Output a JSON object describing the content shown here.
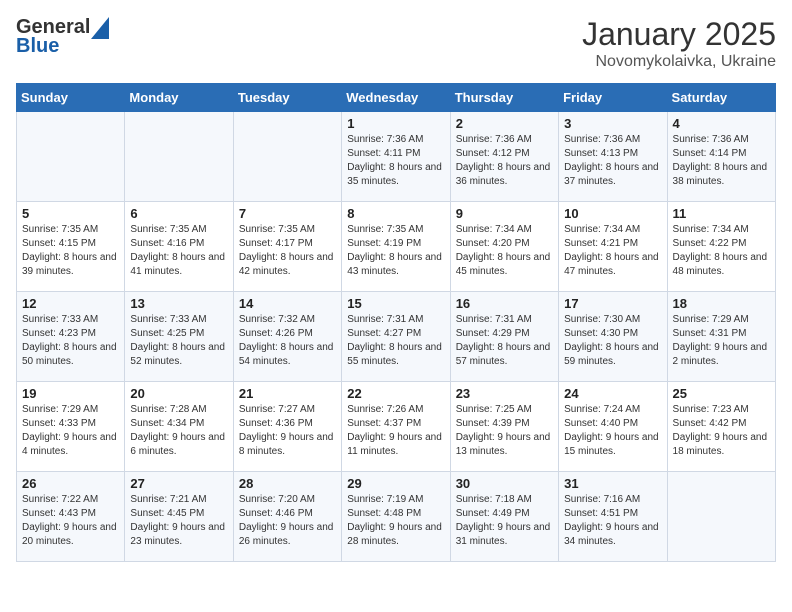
{
  "header": {
    "logo_general": "General",
    "logo_blue": "Blue",
    "month": "January 2025",
    "location": "Novomykolaivka, Ukraine"
  },
  "weekdays": [
    "Sunday",
    "Monday",
    "Tuesday",
    "Wednesday",
    "Thursday",
    "Friday",
    "Saturday"
  ],
  "weeks": [
    [
      {
        "day": "",
        "info": ""
      },
      {
        "day": "",
        "info": ""
      },
      {
        "day": "",
        "info": ""
      },
      {
        "day": "1",
        "info": "Sunrise: 7:36 AM\nSunset: 4:11 PM\nDaylight: 8 hours and 35 minutes."
      },
      {
        "day": "2",
        "info": "Sunrise: 7:36 AM\nSunset: 4:12 PM\nDaylight: 8 hours and 36 minutes."
      },
      {
        "day": "3",
        "info": "Sunrise: 7:36 AM\nSunset: 4:13 PM\nDaylight: 8 hours and 37 minutes."
      },
      {
        "day": "4",
        "info": "Sunrise: 7:36 AM\nSunset: 4:14 PM\nDaylight: 8 hours and 38 minutes."
      }
    ],
    [
      {
        "day": "5",
        "info": "Sunrise: 7:35 AM\nSunset: 4:15 PM\nDaylight: 8 hours and 39 minutes."
      },
      {
        "day": "6",
        "info": "Sunrise: 7:35 AM\nSunset: 4:16 PM\nDaylight: 8 hours and 41 minutes."
      },
      {
        "day": "7",
        "info": "Sunrise: 7:35 AM\nSunset: 4:17 PM\nDaylight: 8 hours and 42 minutes."
      },
      {
        "day": "8",
        "info": "Sunrise: 7:35 AM\nSunset: 4:19 PM\nDaylight: 8 hours and 43 minutes."
      },
      {
        "day": "9",
        "info": "Sunrise: 7:34 AM\nSunset: 4:20 PM\nDaylight: 8 hours and 45 minutes."
      },
      {
        "day": "10",
        "info": "Sunrise: 7:34 AM\nSunset: 4:21 PM\nDaylight: 8 hours and 47 minutes."
      },
      {
        "day": "11",
        "info": "Sunrise: 7:34 AM\nSunset: 4:22 PM\nDaylight: 8 hours and 48 minutes."
      }
    ],
    [
      {
        "day": "12",
        "info": "Sunrise: 7:33 AM\nSunset: 4:23 PM\nDaylight: 8 hours and 50 minutes."
      },
      {
        "day": "13",
        "info": "Sunrise: 7:33 AM\nSunset: 4:25 PM\nDaylight: 8 hours and 52 minutes."
      },
      {
        "day": "14",
        "info": "Sunrise: 7:32 AM\nSunset: 4:26 PM\nDaylight: 8 hours and 54 minutes."
      },
      {
        "day": "15",
        "info": "Sunrise: 7:31 AM\nSunset: 4:27 PM\nDaylight: 8 hours and 55 minutes."
      },
      {
        "day": "16",
        "info": "Sunrise: 7:31 AM\nSunset: 4:29 PM\nDaylight: 8 hours and 57 minutes."
      },
      {
        "day": "17",
        "info": "Sunrise: 7:30 AM\nSunset: 4:30 PM\nDaylight: 8 hours and 59 minutes."
      },
      {
        "day": "18",
        "info": "Sunrise: 7:29 AM\nSunset: 4:31 PM\nDaylight: 9 hours and 2 minutes."
      }
    ],
    [
      {
        "day": "19",
        "info": "Sunrise: 7:29 AM\nSunset: 4:33 PM\nDaylight: 9 hours and 4 minutes."
      },
      {
        "day": "20",
        "info": "Sunrise: 7:28 AM\nSunset: 4:34 PM\nDaylight: 9 hours and 6 minutes."
      },
      {
        "day": "21",
        "info": "Sunrise: 7:27 AM\nSunset: 4:36 PM\nDaylight: 9 hours and 8 minutes."
      },
      {
        "day": "22",
        "info": "Sunrise: 7:26 AM\nSunset: 4:37 PM\nDaylight: 9 hours and 11 minutes."
      },
      {
        "day": "23",
        "info": "Sunrise: 7:25 AM\nSunset: 4:39 PM\nDaylight: 9 hours and 13 minutes."
      },
      {
        "day": "24",
        "info": "Sunrise: 7:24 AM\nSunset: 4:40 PM\nDaylight: 9 hours and 15 minutes."
      },
      {
        "day": "25",
        "info": "Sunrise: 7:23 AM\nSunset: 4:42 PM\nDaylight: 9 hours and 18 minutes."
      }
    ],
    [
      {
        "day": "26",
        "info": "Sunrise: 7:22 AM\nSunset: 4:43 PM\nDaylight: 9 hours and 20 minutes."
      },
      {
        "day": "27",
        "info": "Sunrise: 7:21 AM\nSunset: 4:45 PM\nDaylight: 9 hours and 23 minutes."
      },
      {
        "day": "28",
        "info": "Sunrise: 7:20 AM\nSunset: 4:46 PM\nDaylight: 9 hours and 26 minutes."
      },
      {
        "day": "29",
        "info": "Sunrise: 7:19 AM\nSunset: 4:48 PM\nDaylight: 9 hours and 28 minutes."
      },
      {
        "day": "30",
        "info": "Sunrise: 7:18 AM\nSunset: 4:49 PM\nDaylight: 9 hours and 31 minutes."
      },
      {
        "day": "31",
        "info": "Sunrise: 7:16 AM\nSunset: 4:51 PM\nDaylight: 9 hours and 34 minutes."
      },
      {
        "day": "",
        "info": ""
      }
    ]
  ]
}
